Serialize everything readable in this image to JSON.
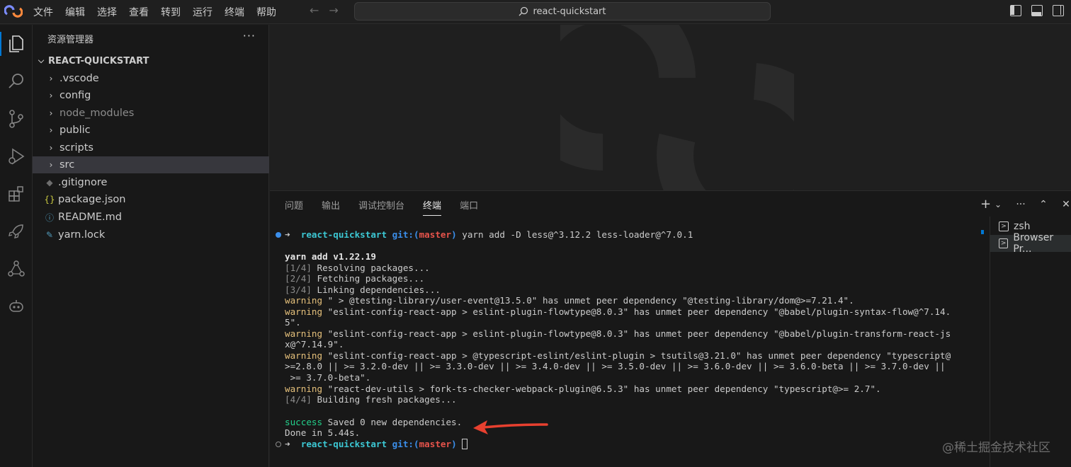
{
  "titlebar": {
    "menu": [
      "文件",
      "编辑",
      "选择",
      "查看",
      "转到",
      "运行",
      "终端",
      "帮助"
    ],
    "search_text": "react-quickstart",
    "icons": [
      "app-logo",
      "back-arrow-icon",
      "forward-arrow-icon",
      "search-icon",
      "toggle-sidebar-icon",
      "toggle-panel-icon",
      "toggle-secondary-sidebar-icon"
    ]
  },
  "activitybar": {
    "items": [
      "explorer-icon",
      "search-icon",
      "source-control-icon",
      "run-debug-icon",
      "extensions-icon",
      "rocket-icon",
      "share-icon",
      "robot-icon"
    ]
  },
  "sidebar": {
    "header": "资源管理器",
    "more": "···",
    "root": "REACT-QUICKSTART",
    "items": [
      {
        "label": ".vscode",
        "type": "folder"
      },
      {
        "label": "config",
        "type": "folder"
      },
      {
        "label": "node_modules",
        "type": "folder"
      },
      {
        "label": "public",
        "type": "folder"
      },
      {
        "label": "scripts",
        "type": "folder"
      },
      {
        "label": "src",
        "type": "folder"
      },
      {
        "label": ".gitignore",
        "type": "file"
      },
      {
        "label": "package.json",
        "type": "file",
        "icon": "{}"
      },
      {
        "label": "README.md",
        "type": "file",
        "icon": "ⓘ"
      },
      {
        "label": "yarn.lock",
        "type": "file"
      }
    ]
  },
  "panel": {
    "tabs": [
      "问题",
      "输出",
      "调试控制台",
      "终端",
      "端口"
    ],
    "active_tab": "终端",
    "actions": [
      "+",
      "⌄",
      "···",
      "⌃",
      "✕"
    ],
    "terminals": [
      "zsh",
      "Browser Pr..."
    ]
  },
  "terminal": {
    "prompt_dir": "react-quickstart",
    "git_label": "git:(",
    "branch": "master",
    "git_close": ")",
    "command": " yarn add -D less@^3.12.2 less-loader@^7.0.1",
    "yarn_version": "yarn add v1.22.19",
    "steps": [
      {
        "tag": "[1/4]",
        "text": " Resolving packages..."
      },
      {
        "tag": "[2/4]",
        "text": " Fetching packages..."
      },
      {
        "tag": "[3/4]",
        "text": " Linking dependencies..."
      }
    ],
    "warning_label": "warning",
    "warnings": [
      " \" > @testing-library/user-event@13.5.0\" has unmet peer dependency \"@testing-library/dom@>=7.21.4\".",
      " \"eslint-config-react-app > eslint-plugin-flowtype@8.0.3\" has unmet peer dependency \"@babel/plugin-syntax-flow@^7.14.",
      "5\".",
      " \"eslint-config-react-app > eslint-plugin-flowtype@8.0.3\" has unmet peer dependency \"@babel/plugin-transform-react-js",
      "x@^7.14.9\".",
      " \"eslint-config-react-app > @typescript-eslint/eslint-plugin > tsutils@3.21.0\" has unmet peer dependency \"typescript@",
      ">=2.8.0 || >= 3.2.0-dev || >= 3.3.0-dev || >= 3.4.0-dev || >= 3.5.0-dev || >= 3.6.0-dev || >= 3.6.0-beta || >= 3.7.0-dev ||",
      " >= 3.7.0-beta\".",
      " \"react-dev-utils > fork-ts-checker-webpack-plugin@6.5.3\" has unmet peer dependency \"typescript@>= 2.7\"."
    ],
    "step4": {
      "tag": "[4/4]",
      "text": " Building fresh packages..."
    },
    "success_label": "success",
    "success_text": " Saved 0 new dependencies.",
    "done_text": "Done in 5.44s."
  },
  "watermark": "@稀土掘金技术社区",
  "colors": {
    "accent": "#0078d4",
    "annotation_arrow": "#e8402f"
  }
}
